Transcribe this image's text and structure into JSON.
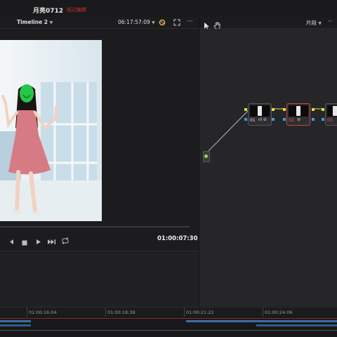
{
  "project": {
    "title": "月亮0712",
    "status": "经过编辑"
  },
  "viewer": {
    "timeline_name": "Timeline 2",
    "source_timecode": "06:17:57:09",
    "record_timecode": "01:00:07:30"
  },
  "node_panel": {
    "mode_label": "片段"
  },
  "nodes": [
    {
      "label": "01"
    },
    {
      "label": "02"
    },
    {
      "label": "03"
    }
  ],
  "timeline_ruler": [
    "01:00:16:04",
    "01:00:18:38",
    "01:00:21:22",
    "01:00:24:06"
  ],
  "colors": {
    "accent_red": "#cc3333",
    "selected_node": "#c4473b",
    "connector": "#b5b5b5",
    "clip_blue": "#3a6ea8"
  },
  "icons": [
    "chevron-down-icon",
    "color-wheel-icon",
    "fit-icon",
    "more-icon",
    "pointer-icon",
    "hand-icon",
    "jump-start-icon",
    "prev-frame-icon",
    "stop-icon",
    "play-icon",
    "jump-end-icon",
    "loop-icon"
  ]
}
